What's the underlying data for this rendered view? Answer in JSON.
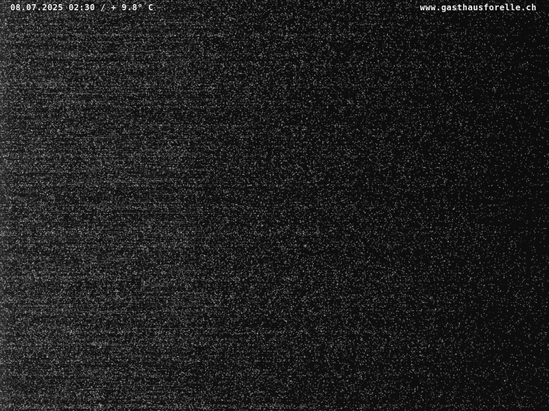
{
  "overlay": {
    "datetime_temp": "08.07.2025 02:30 / + 9.8° C",
    "site": "www.gasthausforelle.ch"
  },
  "colors": {
    "background": "#0c0c0c",
    "overlay_text": "#f2f2f2"
  }
}
